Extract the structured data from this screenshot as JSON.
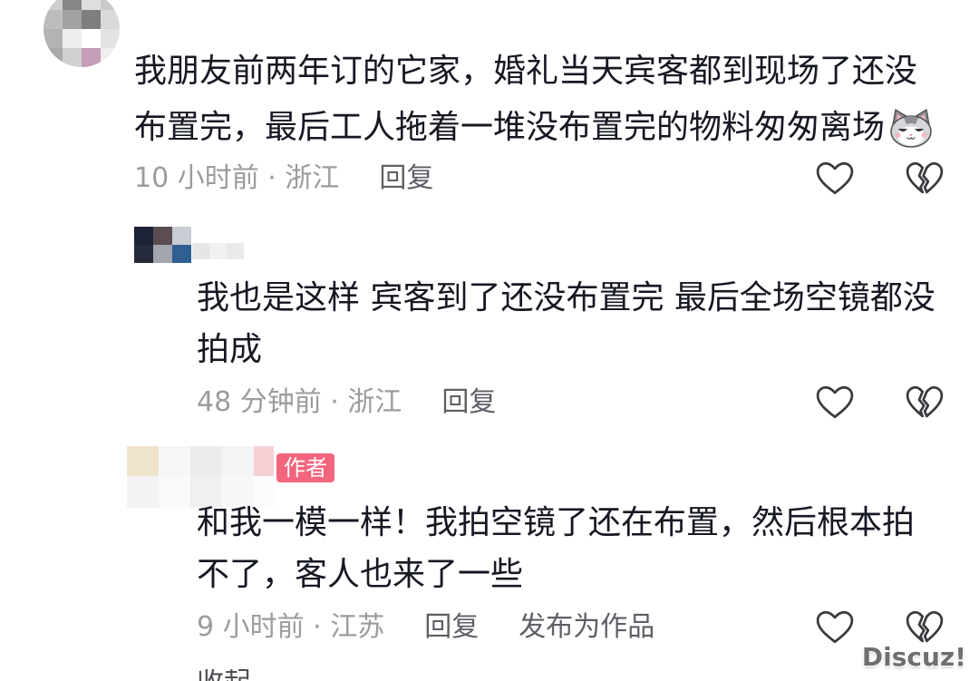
{
  "comment": {
    "lines": [
      "我朋友前两年订的它家，婚礼当天宾客都到现场了还没",
      "布置完，最后工人拖着一堆没布置完的物料匆匆离场"
    ],
    "trailing_emoji": "cat-face-emoji",
    "meta": "10 小时前 · 浙江",
    "reply_label": "回复"
  },
  "replies": [
    {
      "lines": [
        "我也是这样 宾客到了还没布置完 最后全场空镜都没",
        "拍成"
      ],
      "meta": "48 分钟前 · 浙江",
      "reply_label": "回复"
    },
    {
      "author_badge": "作者",
      "lines": [
        "和我一模一样！我拍空镜了还在布置，然后根本拍",
        "不了，客人也来了一些"
      ],
      "meta": "9 小时前 · 江苏",
      "reply_label": "回复",
      "publish_label": "发布为作品"
    }
  ],
  "icons": {
    "like": "heart-outline-icon",
    "dislike": "broken-heart-icon"
  },
  "collapse_label": "收起",
  "watermark": "Discuz!",
  "colors": {
    "text": "#161823",
    "meta": "#9b9ba0",
    "action": "#5e5e66",
    "author_tag_bg": "#f3647d",
    "author_tag_text": "#ffffff",
    "icon": "#3a3a3e",
    "watermark": "#6f6f72"
  }
}
